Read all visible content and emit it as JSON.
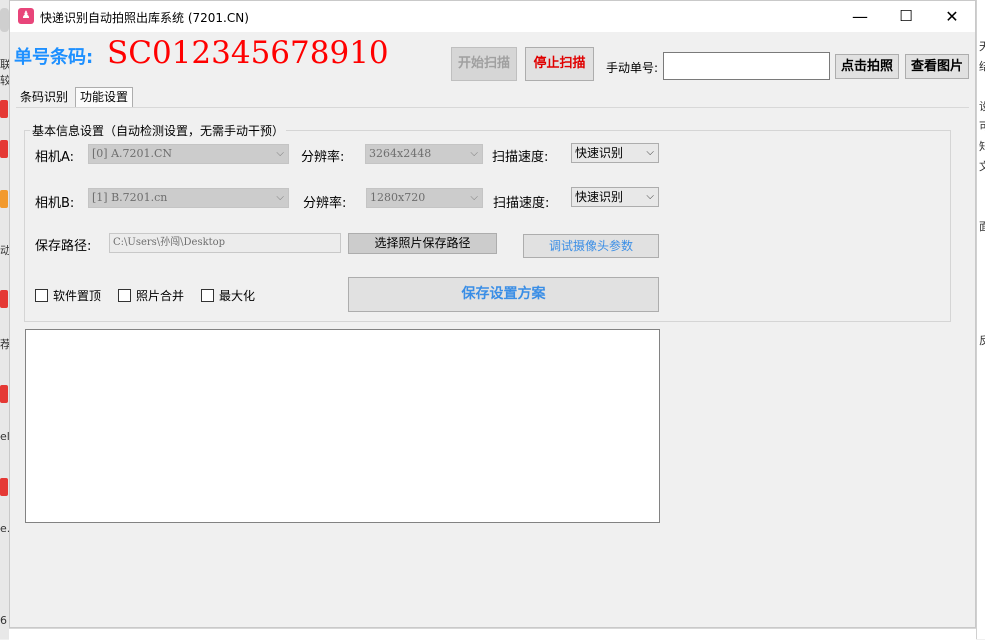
{
  "window": {
    "title": "快递识别自动拍照出库系统 (7201.CN)",
    "app_icon_glyph": "♟",
    "controls": {
      "minimize": "—",
      "maximize": "☐",
      "close": "✕"
    }
  },
  "header": {
    "barcode_label": "单号条码:",
    "barcode_value": "SC012345678910",
    "start_scan": "开始扫描",
    "stop_scan": "停止扫描",
    "manual_label": "手动单号:",
    "manual_value": "",
    "capture": "点击拍照",
    "view_images": "查看图片"
  },
  "tabs": [
    {
      "label": "条码识别",
      "active": false
    },
    {
      "label": "功能设置",
      "active": true
    }
  ],
  "settings": {
    "group_title": "基本信息设置（自动检测设置，无需手动干预）",
    "camera_a": {
      "label": "相机A:",
      "device": "[0] A.7201.CN",
      "res_label": "分辨率:",
      "resolution": "3264x2448",
      "speed_label": "扫描速度:",
      "speed": "快速识别"
    },
    "camera_b": {
      "label": "相机B:",
      "device": "[1] B.7201.cn",
      "res_label": "分辨率:",
      "resolution": "1280x720",
      "speed_label": "扫描速度:",
      "speed": "快速识别"
    },
    "path_label": "保存路径:",
    "path_value": "C:\\Users\\孙闯\\Desktop",
    "choose_path": "选择照片保存路径",
    "camera_params": "调试摄像头参数",
    "options": [
      {
        "label": "软件置顶",
        "checked": false
      },
      {
        "label": "照片合并",
        "checked": false
      },
      {
        "label": "最大化",
        "checked": false
      }
    ],
    "save_scheme": "保存设置方案"
  },
  "log": {
    "content": ""
  },
  "background": {
    "left_text": [
      "联",
      "较",
      "动",
      "荐",
      "el",
      "e.",
      "6"
    ],
    "right_text": [
      "天",
      "结",
      "设",
      "可",
      "知",
      "文",
      "面",
      "反"
    ]
  },
  "colors": {
    "accent_blue": "#1e90ff",
    "barcode_red": "#ff0000",
    "stop_red": "#e00000",
    "link_blue": "#3a8ee6"
  }
}
